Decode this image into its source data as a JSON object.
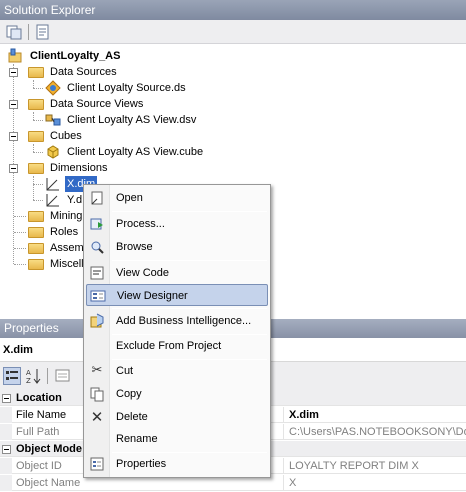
{
  "solution_explorer": {
    "title": "Solution Explorer",
    "tree": {
      "project": "ClientLoyalty_AS",
      "folders": [
        {
          "label": "Data Sources",
          "children": [
            "Client Loyalty Source.ds"
          ]
        },
        {
          "label": "Data Source Views",
          "children": [
            "Client Loyalty AS View.dsv"
          ]
        },
        {
          "label": "Cubes",
          "children": [
            "Client Loyalty AS View.cube"
          ]
        },
        {
          "label": "Dimensions",
          "children": [
            "X.dim",
            "Y.d"
          ]
        },
        {
          "label": "Mining S"
        },
        {
          "label": "Roles"
        },
        {
          "label": "Assemb"
        },
        {
          "label": "Miscella"
        }
      ]
    }
  },
  "context_menu": {
    "items": [
      "Open",
      "Process...",
      "Browse",
      "View Code",
      "View Designer",
      "Add Business Intelligence...",
      "Exclude From Project",
      "Cut",
      "Copy",
      "Delete",
      "Rename",
      "Properties"
    ],
    "highlighted": "View Designer"
  },
  "properties": {
    "title": "Properties",
    "object": "X.dim",
    "categories": [
      {
        "name": "Location",
        "rows": [
          {
            "name": "File Name",
            "value": "X.dim"
          },
          {
            "name": "Full Path",
            "value": "C:\\Users\\PAS.NOTEBOOKSONY\\Docu"
          }
        ]
      },
      {
        "name": "Object Mode",
        "rows": [
          {
            "name": "Object ID",
            "value": "LOYALTY REPORT DIM X"
          },
          {
            "name": "Object Name",
            "value": "X"
          }
        ]
      }
    ]
  }
}
